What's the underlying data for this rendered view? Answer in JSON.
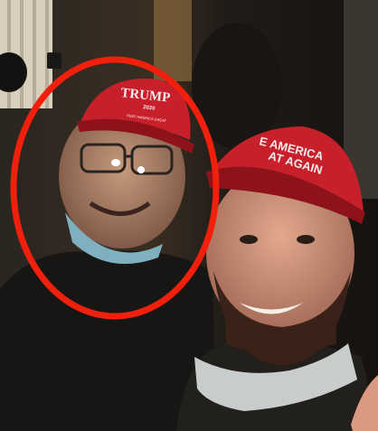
{
  "photo": {
    "left_hat_text": [
      "TRUMP",
      "2020",
      "KEEP AMERICA GREAT"
    ],
    "right_hat_text": [
      "E AMERICA",
      "AT AGAIN"
    ],
    "colors": {
      "hat_red": "#c8202a",
      "circle_red": "#f0200c",
      "background": "#0d0b0a",
      "column": "#d8d0bc"
    }
  }
}
